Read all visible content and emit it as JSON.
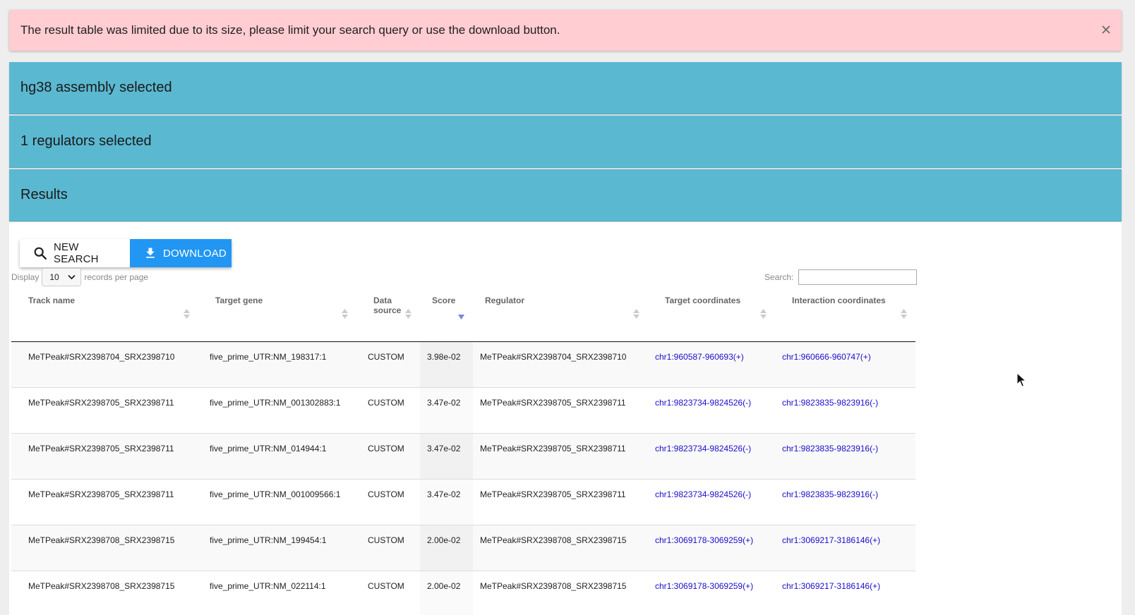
{
  "alert": {
    "message": "The result table was limited due to its size, please limit your search query or use the download button.",
    "close_icon": "close-icon"
  },
  "panels": {
    "assembly": "hg38 assembly selected",
    "regulators": "1 regulators selected",
    "results": "Results"
  },
  "toolbar": {
    "new_search_label": "NEW SEARCH",
    "download_label": "DOWNLOAD"
  },
  "table_controls": {
    "display_label": "Display",
    "page_size": "10",
    "records_label": "records per page",
    "search_label": "Search:",
    "search_value": ""
  },
  "table": {
    "columns": [
      "Track name",
      "Target gene",
      "Data source",
      "Score",
      "Regulator",
      "Target coordinates",
      "Interaction coordinates"
    ],
    "rows": [
      [
        "MeTPeak#SRX2398704_SRX2398710",
        "five_prime_UTR:NM_198317:1",
        "CUSTOM",
        "3.98e-02",
        "MeTPeak#SRX2398704_SRX2398710",
        "chr1:960587-960693(+)",
        "chr1:960666-960747(+)"
      ],
      [
        "MeTPeak#SRX2398705_SRX2398711",
        "five_prime_UTR:NM_001302883:1",
        "CUSTOM",
        "3.47e-02",
        "MeTPeak#SRX2398705_SRX2398711",
        "chr1:9823734-9824526(-)",
        "chr1:9823835-9823916(-)"
      ],
      [
        "MeTPeak#SRX2398705_SRX2398711",
        "five_prime_UTR:NM_014944:1",
        "CUSTOM",
        "3.47e-02",
        "MeTPeak#SRX2398705_SRX2398711",
        "chr1:9823734-9824526(-)",
        "chr1:9823835-9823916(-)"
      ],
      [
        "MeTPeak#SRX2398705_SRX2398711",
        "five_prime_UTR:NM_001009566:1",
        "CUSTOM",
        "3.47e-02",
        "MeTPeak#SRX2398705_SRX2398711",
        "chr1:9823734-9824526(-)",
        "chr1:9823835-9823916(-)"
      ],
      [
        "MeTPeak#SRX2398708_SRX2398715",
        "five_prime_UTR:NM_199454:1",
        "CUSTOM",
        "2.00e-02",
        "MeTPeak#SRX2398708_SRX2398715",
        "chr1:3069178-3069259(+)",
        "chr1:3069217-3186146(+)"
      ],
      [
        "MeTPeak#SRX2398708_SRX2398715",
        "five_prime_UTR:NM_022114:1",
        "CUSTOM",
        "2.00e-02",
        "MeTPeak#SRX2398708_SRX2398715",
        "chr1:3069178-3069259(+)",
        "chr1:3069217-3186146(+)"
      ]
    ]
  },
  "colors": {
    "alert_bg": "#ffcdd2",
    "panel_bg": "#5bb8d1",
    "download_bg": "#2196f3",
    "link": "#1a0dcc"
  }
}
